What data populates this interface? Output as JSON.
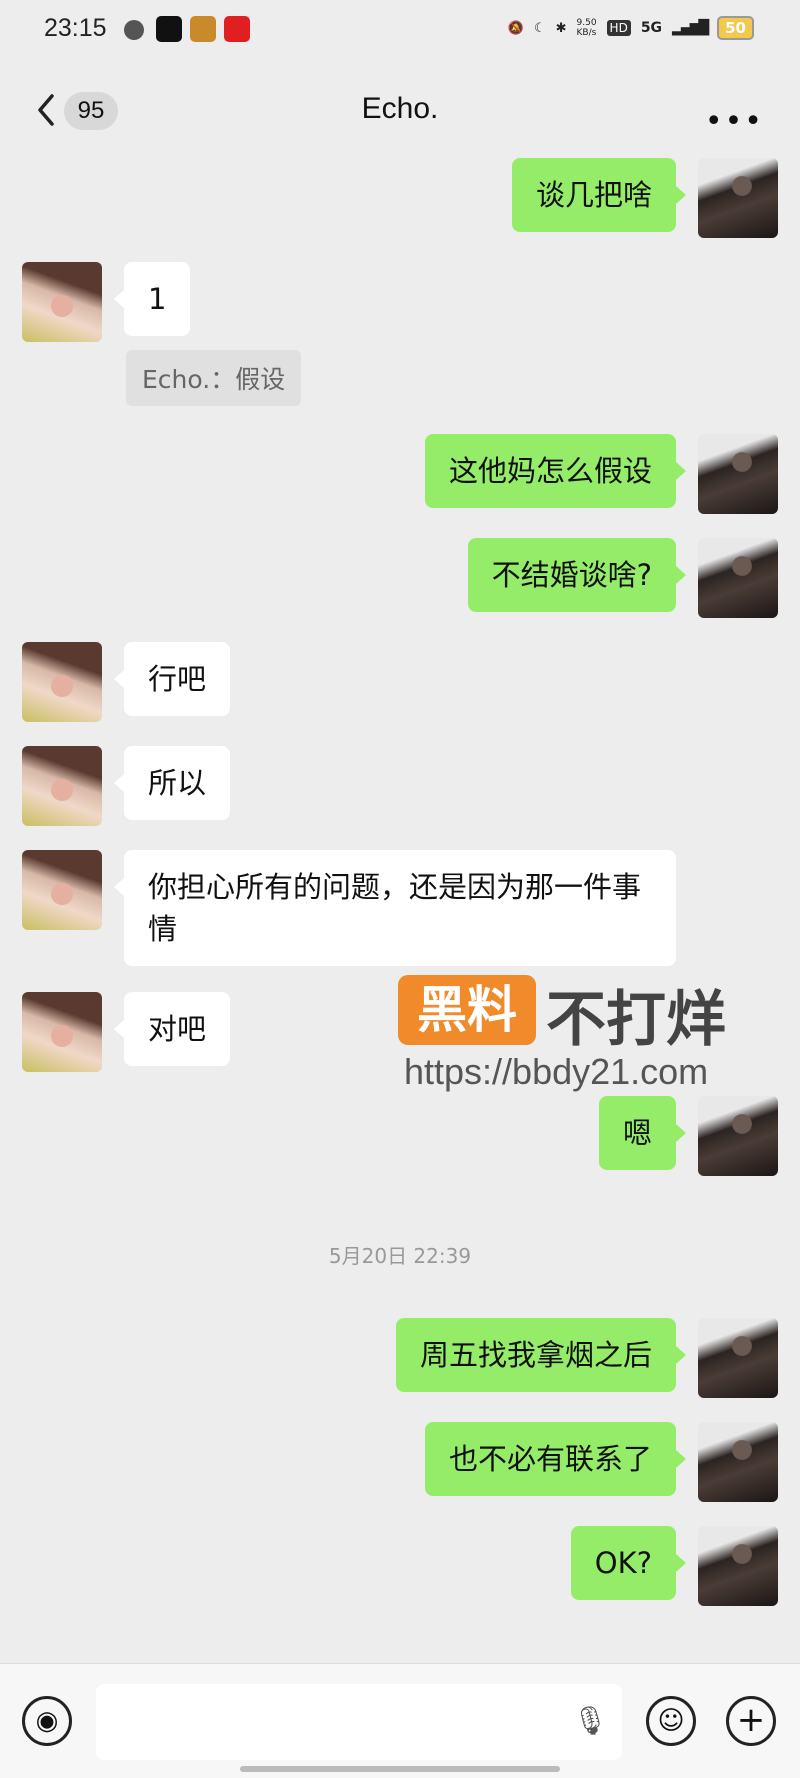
{
  "status": {
    "time": "23:15",
    "speed": "9.50\nKB/s",
    "hd": "HD",
    "network": "5G",
    "battery": "50"
  },
  "nav": {
    "unread_count": "95",
    "title": "Echo."
  },
  "messages": [
    {
      "side": "out",
      "text": "谈几把啥"
    },
    {
      "side": "in",
      "text": "1"
    },
    {
      "side": "quote",
      "text": "Echo.：假设"
    },
    {
      "side": "out",
      "text": "这他妈怎么假设"
    },
    {
      "side": "out",
      "text": "不结婚谈啥?"
    },
    {
      "side": "in",
      "text": "行吧"
    },
    {
      "side": "in",
      "text": "所以"
    },
    {
      "side": "in",
      "text": "你担心所有的问题，还是因为那一件事情"
    },
    {
      "side": "in",
      "text": "对吧"
    },
    {
      "side": "out",
      "text": "嗯"
    },
    {
      "side": "time",
      "text": "5月20日 22:39"
    },
    {
      "side": "out",
      "text": "周五找我拿烟之后"
    },
    {
      "side": "out",
      "text": "也不必有联系了"
    },
    {
      "side": "out",
      "text": "OK?"
    }
  ],
  "watermark": {
    "box": "黑料",
    "text": "不打烊",
    "url": "https://bbdy21.com"
  },
  "icons": {
    "back": "chevron-left-icon",
    "more": "more-dots-icon",
    "voice": "voice-icon",
    "mic": "mic-icon",
    "emoji": "emoji-icon",
    "plus": "plus-icon"
  }
}
